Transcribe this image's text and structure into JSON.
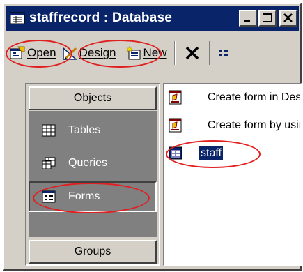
{
  "window": {
    "title": "staffrecord : Database",
    "title_icon": "database-window-icon",
    "controls": {
      "minimize": "minimize-icon",
      "maximize": "maximize-icon",
      "close": "close-icon"
    }
  },
  "toolbar": {
    "open_label": "Open",
    "design_label": "Design",
    "new_label": "New",
    "delete_icon": "delete-x-icon",
    "more_icon": "large-icons-view-icon"
  },
  "objects_bar": {
    "header": "Objects",
    "items": [
      {
        "label": "Tables",
        "icon": "table-icon",
        "selected": false
      },
      {
        "label": "Queries",
        "icon": "query-icon",
        "selected": false
      },
      {
        "label": "Forms",
        "icon": "form-icon",
        "selected": true
      }
    ],
    "footer": "Groups"
  },
  "list": {
    "items": [
      {
        "label": "Create form in Design view",
        "icon": "create-form-wizard-icon",
        "selected": false
      },
      {
        "label": "Create form by using wizard",
        "icon": "create-form-wizard-icon",
        "selected": false
      },
      {
        "label": "staff",
        "icon": "form-object-icon",
        "selected": true
      }
    ]
  },
  "colors": {
    "titlebar": "#0a246a",
    "chrome": "#d4d0c8",
    "objects_bg": "#808080",
    "annotation": "#e02020"
  }
}
